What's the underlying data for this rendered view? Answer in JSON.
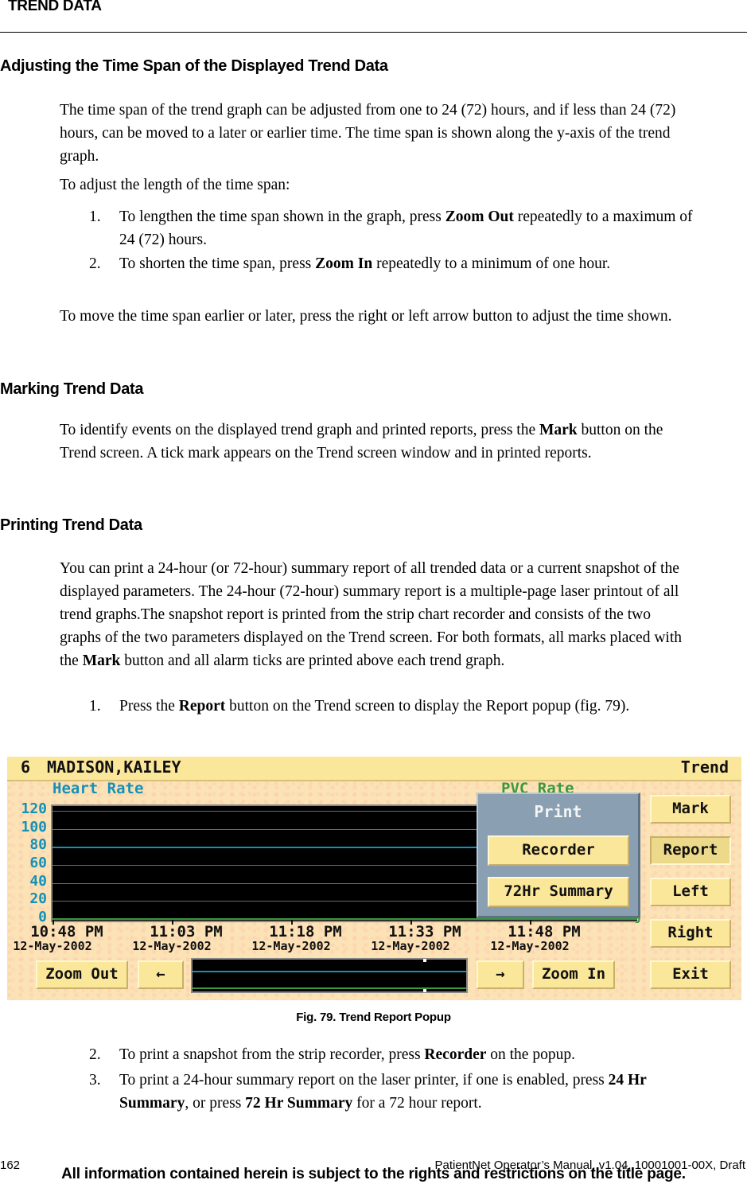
{
  "running_head": "TREND DATA",
  "sections": [
    {
      "heading": "Adjusting the Time Span of the Displayed Trend Data",
      "paragraphs": [
        "The time span of the trend graph can be adjusted from one to 24 (72) hours, and if less than 24 (72) hours, can be moved to a later or earlier time. The time span is shown along the y-axis of the trend graph.",
        "To adjust the length of the time span:"
      ],
      "steps": [
        {
          "num": "1.",
          "pre": "To lengthen the time span shown in the graph, press ",
          "bold": "Zoom Out",
          "post": " repeatedly to a maximum of 24 (72) hours."
        },
        {
          "num": "2.",
          "pre": "To shorten the time span, press ",
          "bold": "Zoom In",
          "post": " repeatedly to a minimum of one hour."
        }
      ],
      "closing": "To move the time span earlier or later, press the right or left arrow button to adjust the time shown."
    },
    {
      "heading": "Marking Trend Data",
      "para_pre": "To identify events on the displayed trend graph and printed reports, press the ",
      "para_bold": "Mark",
      "para_post": " button on the Trend screen. A tick mark appears on the Trend screen window and in printed reports."
    },
    {
      "heading": "Printing Trend Data",
      "para_pre": "You can print a 24-hour (or 72-hour) summary report of all trended data or a current snapshot of the displayed parameters. The 24-hour (72-hour) summary report is a multiple-page laser printout of all trend graphs.The snapshot report is printed from the strip chart recorder and consists of the two graphs of the two parameters displayed on the Trend screen. For both formats, all marks placed with the ",
      "para_bold": "Mark",
      "para_post": " button and all alarm ticks are printed above each trend graph.",
      "steps": [
        {
          "num": "1.",
          "pre": "Press the ",
          "bold": "Report",
          "post": " button on the Trend screen to display the Report popup (fig. 79)."
        },
        {
          "num": "2.",
          "pre": "To print a snapshot from the strip recorder, press ",
          "bold": "Recorder",
          "post": " on the popup."
        },
        {
          "num": "3.",
          "pre": "To print a 24-hour summary report on the laser printer, if one is enabled, press ",
          "bold": "24 Hr Summary",
          "mid": ", or press ",
          "bold2": "72 Hr Summary",
          "post": " for a 72 hour report."
        }
      ]
    }
  ],
  "figure": {
    "caption": "Fig. 79. Trend Report Popup",
    "screen": {
      "bed": "6",
      "patient": "MADISON,KAILEY",
      "screen_name": "Trend",
      "param1": "Heart Rate",
      "param2": "PVC Rate",
      "side_buttons": [
        "Mark",
        "Report",
        "Left",
        "Right",
        "Exit"
      ],
      "pressed_button": "Report",
      "bottom_buttons": {
        "zoom_out": "Zoom Out",
        "left_arrow": "←",
        "right_arrow": "→",
        "zoom_in": "Zoom In"
      },
      "popup": {
        "title": "Print",
        "buttons": [
          "Recorder",
          "72Hr Summary"
        ]
      },
      "colors": {
        "param1": "#1591b8",
        "param2": "#3a9a3a",
        "button": "#fbe79a",
        "popup": "#8aa0b2",
        "titlebar": "#fbe79a"
      }
    },
    "chart_data": {
      "type": "line",
      "title": "Heart Rate",
      "ylabel": "",
      "xlabel": "",
      "y_ticks": [
        "120",
        "100",
        "80",
        "60",
        "40",
        "20",
        "0"
      ],
      "ylim": [
        0,
        120
      ],
      "y2_ticks_visible": [
        "0"
      ],
      "x_ticks": [
        {
          "time": "10:48 PM",
          "date": "12-May-2002"
        },
        {
          "time": "11:03 PM",
          "date": "12-May-2002"
        },
        {
          "time": "11:18 PM",
          "date": "12-May-2002"
        },
        {
          "time": "11:33 PM",
          "date": "12-May-2002"
        },
        {
          "time": "11:48 PM",
          "date": "12-May-2002"
        }
      ],
      "series": [
        {
          "name": "Heart Rate",
          "values": [
            80,
            80,
            80,
            80,
            80
          ],
          "color": "#1591b8"
        },
        {
          "name": "PVC Rate",
          "values": [
            0,
            0,
            0,
            0,
            0
          ],
          "color": "#3a9a3a"
        }
      ],
      "grid": true
    }
  },
  "footer": {
    "page_number": "162",
    "manual_id": "PatientNet Operator’s Manual, v1.04, 10001001-00X, Draft",
    "legal": "All information contained herein is subject to the rights and restrictions on the title page."
  }
}
